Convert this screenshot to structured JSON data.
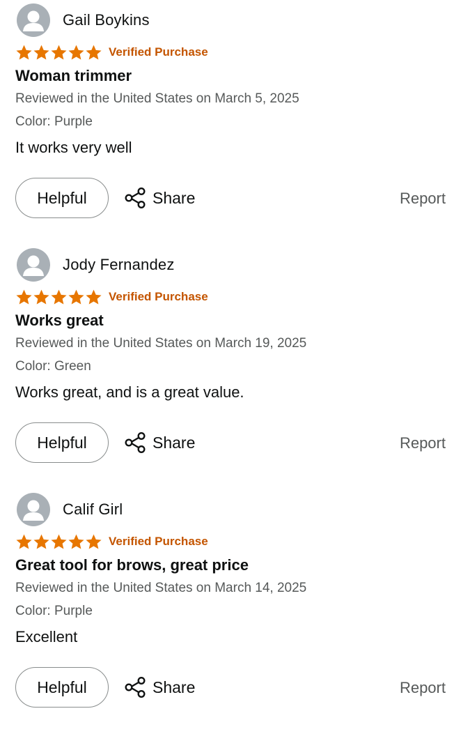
{
  "colors": {
    "star": "#e77600",
    "verified": "#c45500",
    "avatar_bg": "#a9b0b6",
    "text_primary": "#0f1111",
    "text_secondary": "#565959"
  },
  "icons": {
    "avatar": "default-user-avatar-icon",
    "star": "filled-star-icon",
    "share": "share-nodes-icon"
  },
  "reviews": [
    {
      "reviewer": "Gail Boykins",
      "rating": 5,
      "verified_label": "Verified Purchase",
      "title": "Woman trimmer",
      "date_line": "Reviewed in the United States on March 5, 2025",
      "variant": "Color: Purple",
      "body": "It works very well",
      "helpful_label": "Helpful",
      "share_label": "Share",
      "report_label": "Report"
    },
    {
      "reviewer": "Jody Fernandez",
      "rating": 5,
      "verified_label": "Verified Purchase",
      "title": "Works great",
      "date_line": "Reviewed in the United States on March 19, 2025",
      "variant": "Color: Green",
      "body": "Works great, and is a great value.",
      "helpful_label": "Helpful",
      "share_label": "Share",
      "report_label": "Report"
    },
    {
      "reviewer": "Calif Girl",
      "rating": 5,
      "verified_label": "Verified Purchase",
      "title": "Great tool for brows, great price",
      "date_line": "Reviewed in the United States on March 14, 2025",
      "variant": "Color: Purple",
      "body": "Excellent",
      "helpful_label": "Helpful",
      "share_label": "Share",
      "report_label": "Report"
    }
  ]
}
